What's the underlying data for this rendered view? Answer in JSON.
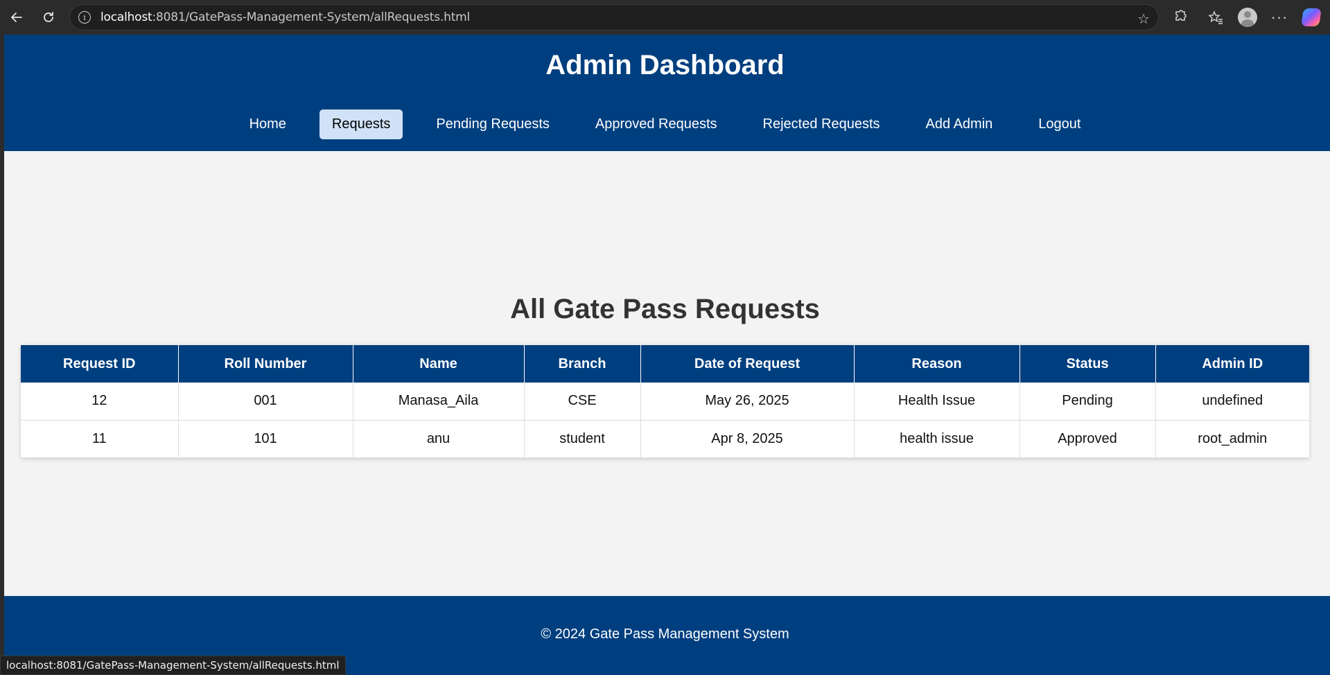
{
  "browser": {
    "url_host": "localhost",
    "url_rest": ":8081/GatePass-Management-System/allRequests.html",
    "status_url": "localhost:8081/GatePass-Management-System/allRequests.html"
  },
  "header": {
    "title": "Admin Dashboard",
    "nav": [
      {
        "label": "Home",
        "active": false
      },
      {
        "label": "Requests",
        "active": true
      },
      {
        "label": "Pending Requests",
        "active": false
      },
      {
        "label": "Approved Requests",
        "active": false
      },
      {
        "label": "Rejected Requests",
        "active": false
      },
      {
        "label": "Add Admin",
        "active": false
      },
      {
        "label": "Logout",
        "active": false
      }
    ]
  },
  "main": {
    "title": "All Gate Pass Requests",
    "table": {
      "columns": [
        "Request ID",
        "Roll Number",
        "Name",
        "Branch",
        "Date of Request",
        "Reason",
        "Status",
        "Admin ID"
      ],
      "rows": [
        [
          "12",
          "001",
          "Manasa_Aila",
          "CSE",
          "May 26, 2025",
          "Health Issue",
          "Pending",
          "undefined"
        ],
        [
          "11",
          "101",
          "anu",
          "student",
          "Apr 8, 2025",
          "health issue",
          "Approved",
          "root_admin"
        ]
      ]
    }
  },
  "footer": {
    "text": "© 2024 Gate Pass Management System"
  },
  "colors": {
    "primary": "#003f7f",
    "active_nav": "#d0e2f7",
    "page_bg": "#f3f3f3"
  },
  "icons": {
    "back": "arrow-left-icon",
    "reload": "reload-icon",
    "info": "info-icon",
    "favorite": "star-icon",
    "extensions": "puzzle-icon",
    "favorites": "favorites-icon",
    "profile": "profile-icon",
    "more": "more-icon",
    "copilot": "copilot-icon"
  }
}
